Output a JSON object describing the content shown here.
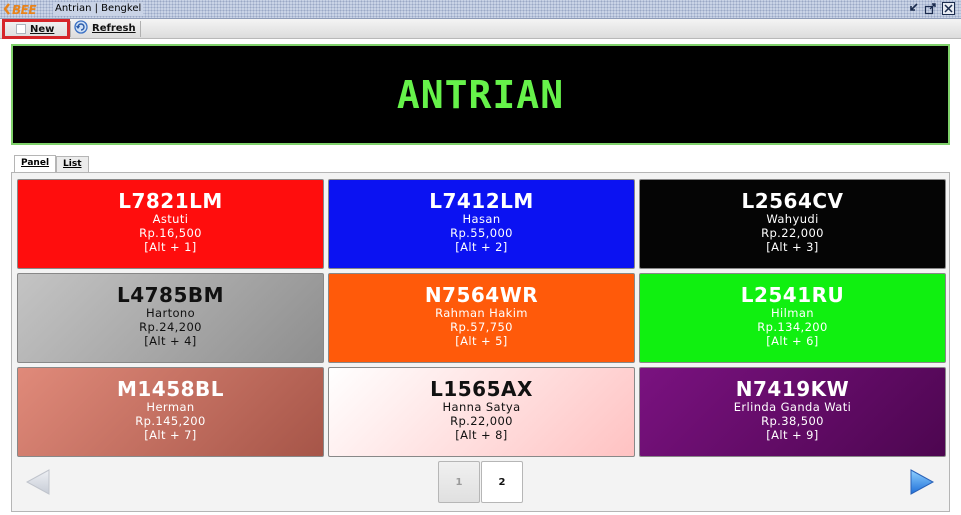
{
  "window": {
    "app_logo": "BEE",
    "title": "Antrian | Bengkel",
    "controls": [
      "minimize-icon",
      "maximize-icon",
      "close-icon"
    ]
  },
  "toolbar": {
    "new_label": "New",
    "refresh_label": "Refresh"
  },
  "display": {
    "text": "ANTRIAN",
    "text_color": "#66f24a",
    "background": "#000000"
  },
  "tabs": [
    {
      "label": "Panel",
      "active": true
    },
    {
      "label": "List",
      "active": false
    }
  ],
  "queue": [
    {
      "plate": "L7821LM",
      "name": "Astuti",
      "amount": "Rp.16,500",
      "shortcut": "[Alt + 1]",
      "color": "#ff0d0d"
    },
    {
      "plate": "L7412LM",
      "name": "Hasan",
      "amount": "Rp.55,000",
      "shortcut": "[Alt + 2]",
      "color": "#0b12f2"
    },
    {
      "plate": "L2564CV",
      "name": "Wahyudi",
      "amount": "Rp.22,000",
      "shortcut": "[Alt + 3]",
      "color": "#050505"
    },
    {
      "plate": "L4785BM",
      "name": "Hartono",
      "amount": "Rp.24,200",
      "shortcut": "[Alt + 4]",
      "color": "#a9a9a9"
    },
    {
      "plate": "N7564WR",
      "name": "Rahman Hakim",
      "amount": "Rp.57,750",
      "shortcut": "[Alt + 5]",
      "color": "#ff5a0a"
    },
    {
      "plate": "L2541RU",
      "name": "Hilman",
      "amount": "Rp.134,200",
      "shortcut": "[Alt + 6]",
      "color": "#10f010"
    },
    {
      "plate": "M1458BL",
      "name": "Herman",
      "amount": "Rp.145,200",
      "shortcut": "[Alt + 7]",
      "color": "#c77466"
    },
    {
      "plate": "L1565AX",
      "name": "Hanna Satya",
      "amount": "Rp.22,000",
      "shortcut": "[Alt + 8]",
      "color": "#ffd6d6"
    },
    {
      "plate": "N7419KW",
      "name": "Erlinda Ganda Wati",
      "amount": "Rp.38,500",
      "shortcut": "[Alt + 9]",
      "color": "#6e0a6e"
    }
  ],
  "pagination": {
    "pages": [
      "1",
      "2"
    ],
    "current": "2"
  },
  "icons": {
    "prev": "arrow-left-icon",
    "next": "arrow-right-icon"
  }
}
